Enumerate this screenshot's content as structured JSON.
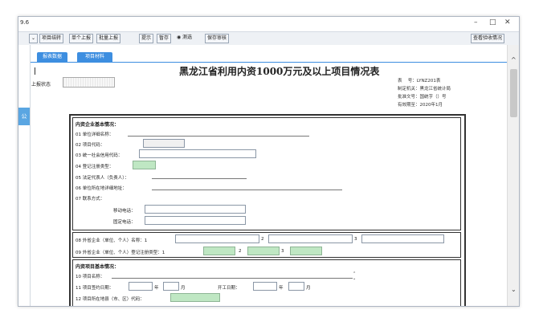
{
  "window": {
    "title": "9.6",
    "controls": {
      "minimize": "–",
      "maximize": "□",
      "close": "✕"
    }
  },
  "toolbar": {
    "dropdown_arrow": "⌄",
    "buttons": [
      "项目结转",
      "单个上报",
      "批量上报",
      "提示",
      "暂存",
      "测选",
      "保存审核"
    ],
    "right_button": "查看验收情况"
  },
  "left_strip": {
    "blue_label": "公"
  },
  "tabs": [
    "报表数据",
    "项目材料"
  ],
  "status": {
    "label": "上报状态"
  },
  "report": {
    "title": "黑龙江省利用内资1000万元及以上项目情况表",
    "meta": [
      "表　 号：LYNZ201表",
      "制定机关：黑龙江省统计局",
      "批准文号：国统字（）号",
      "有效期至：2020年1月"
    ]
  },
  "section1": {
    "header": "内资企业基本情况：",
    "fields": [
      "01 单位详细名称：",
      "02 项目代码：",
      "03 统一社会信用代码：",
      "04 登记注册类型：",
      "05 法定代表人（负责人）：",
      "06 单位所在地详细地址：",
      "07 联系方式："
    ],
    "mobile": "移动电话：",
    "fixed": "固定电话："
  },
  "section2": {
    "row1_label": "08 外省企业（单位、个人）名称：1",
    "row2_label": "09 外省企业（单位、个人）登记注册类型：1",
    "n2": "2",
    "n3": "3"
  },
  "section3": {
    "header": "内资项目基本情况：",
    "name_label": "10 项目名称：",
    "date_label": "11 项目签约日期：",
    "year": "年",
    "month": "月",
    "start_label": "开工日期：",
    "code_label": "12 项目所在地县（市、区）代码："
  },
  "scrollbar": {
    "up": "^",
    "down": "⌄"
  }
}
